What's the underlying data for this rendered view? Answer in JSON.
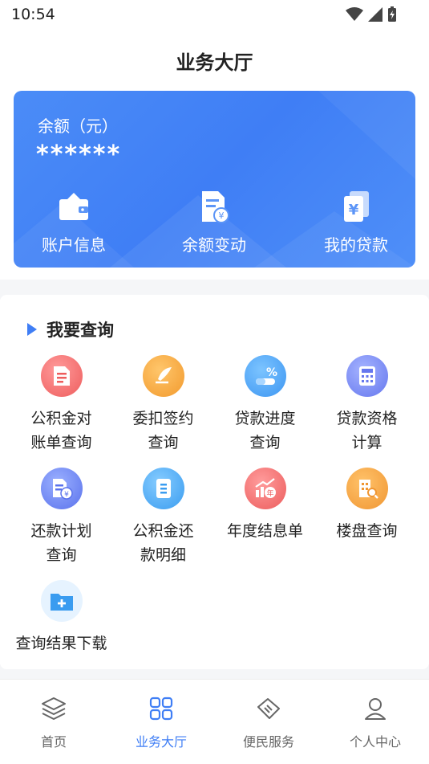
{
  "status_bar": {
    "time": "10:54"
  },
  "header": {
    "title": "业务大厅"
  },
  "balance_card": {
    "label": "余额（元）",
    "value": "******",
    "actions": [
      {
        "label": "账户信息",
        "icon": "wallet-icon"
      },
      {
        "label": "余额变动",
        "icon": "document-yen-icon"
      },
      {
        "label": "我的贷款",
        "icon": "loan-yen-icon"
      }
    ]
  },
  "query": {
    "title": "我要查询",
    "items": [
      {
        "line1": "公积金对",
        "line2": "账单查询",
        "icon": "bill-document-icon",
        "color": "#f36c6c"
      },
      {
        "line1": "委扣签约",
        "line2": "查询",
        "icon": "quill-pen-icon",
        "color": "#f5a23c"
      },
      {
        "line1": "贷款进度",
        "line2": "查询",
        "icon": "percent-progress-icon",
        "color": "#3f9ef5"
      },
      {
        "line1": "贷款资格",
        "line2": "计算",
        "icon": "calculator-icon",
        "color": "#6b7ef0"
      },
      {
        "line1": "还款计划",
        "line2": "查询",
        "icon": "repayment-plan-icon",
        "color": "#5d78ee"
      },
      {
        "line1": "公积金还",
        "line2": "款明细",
        "icon": "detail-list-icon",
        "color": "#3fa3f5"
      },
      {
        "line1": "年度结息单",
        "line2": "",
        "icon": "annual-interest-icon",
        "color": "#f26a6a"
      },
      {
        "line1": "楼盘查询",
        "line2": "",
        "icon": "building-search-icon",
        "color": "#f5a03c"
      },
      {
        "line1": "查询结果下载",
        "line2": "",
        "icon": "folder-add-icon",
        "color": "#3fa3f5"
      }
    ]
  },
  "tabbar": {
    "tabs": [
      {
        "label": "首页",
        "icon": "layers-icon"
      },
      {
        "label": "业务大厅",
        "icon": "grid-icon",
        "active": true
      },
      {
        "label": "便民服务",
        "icon": "tag-service-icon"
      },
      {
        "label": "个人中心",
        "icon": "person-icon"
      }
    ],
    "active_color": "#3f7ef5",
    "inactive_color": "#666666"
  }
}
